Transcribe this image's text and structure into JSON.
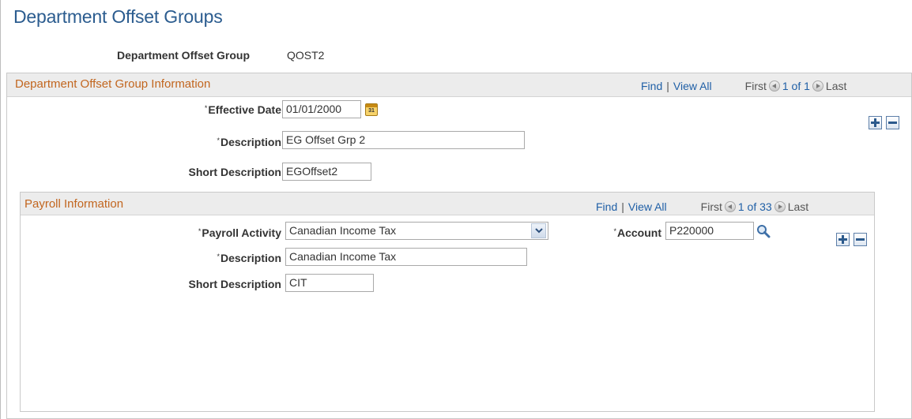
{
  "page": {
    "title": "Department Offset Groups"
  },
  "header": {
    "group_label": "Department Offset Group",
    "group_value": "QOST2"
  },
  "group_info": {
    "title": "Department Offset Group Information",
    "nav": {
      "find": "Find",
      "separator": "|",
      "view_all": "View All",
      "first": "First",
      "range": "1 of 1",
      "last": "Last"
    },
    "fields": {
      "effective_date_label": "Effective Date",
      "effective_date_value": "01/01/2000",
      "description_label": "Description",
      "description_value": "EG Offset Grp 2",
      "short_description_label": "Short Description",
      "short_description_value": "EGOffset2"
    },
    "required_mark": "*"
  },
  "payroll_info": {
    "title": "Payroll Information",
    "nav": {
      "find": "Find",
      "separator": "|",
      "view_all": "View All",
      "first": "First",
      "range": "1 of 33",
      "last": "Last"
    },
    "fields": {
      "payroll_activity_label": "Payroll Activity",
      "payroll_activity_value": "Canadian Income Tax",
      "account_label": "Account",
      "account_value": "P220000",
      "description_label": "Description",
      "description_value": "Canadian Income Tax",
      "short_description_label": "Short Description",
      "short_description_value": "CIT"
    },
    "required_mark": "*"
  },
  "icons": {
    "calendar": "calendar-icon",
    "lookup": "magnifier-icon",
    "add": "plus-icon",
    "delete": "minus-icon",
    "dropdown": "chevron-down-icon",
    "prev": "previous-arrow-icon",
    "next": "next-arrow-icon"
  },
  "colors": {
    "title": "#2b5c8f",
    "section_title": "#c2661f",
    "link": "#1f5fa6"
  }
}
